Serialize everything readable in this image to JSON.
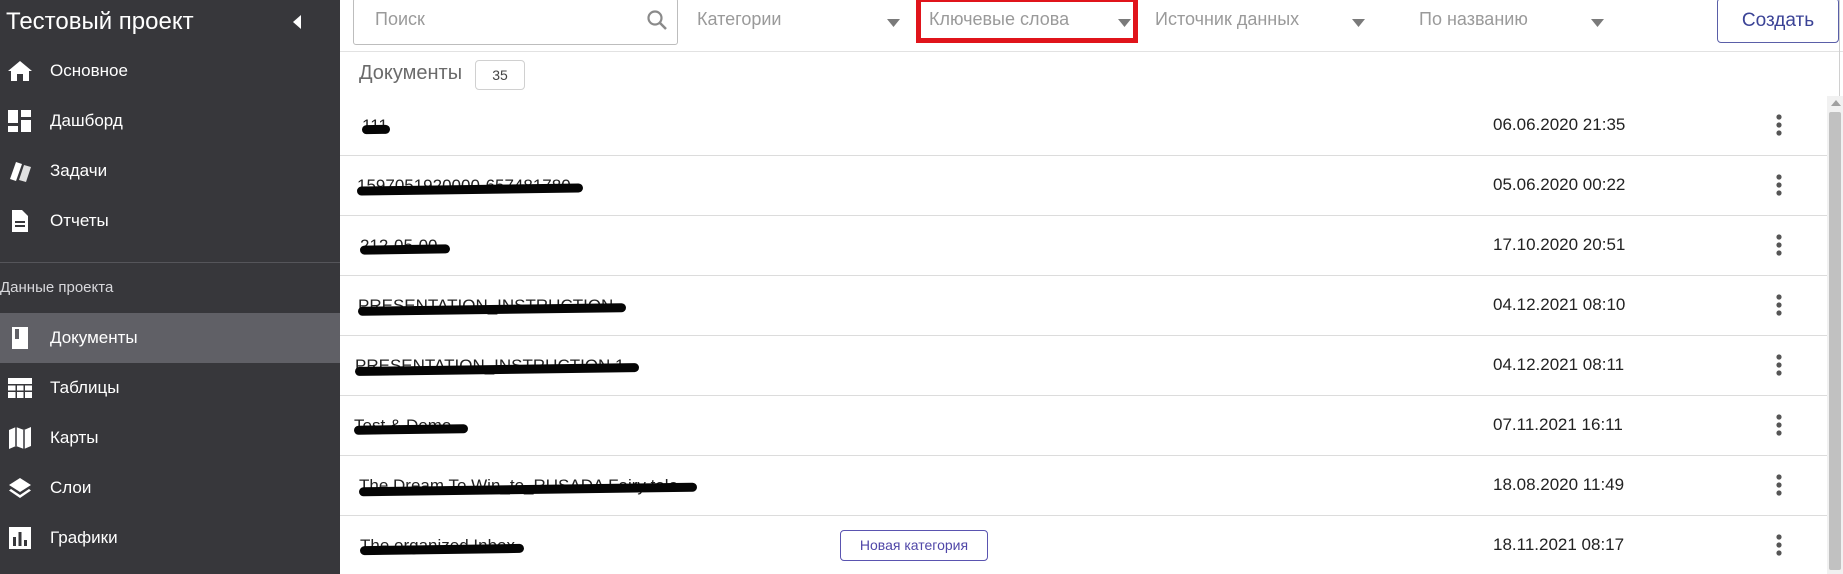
{
  "sidebar": {
    "project_title": "Тестовый проект",
    "nav_items": [
      {
        "label": "Основное",
        "icon": "home-icon"
      },
      {
        "label": "Дашборд",
        "icon": "dashboard-icon"
      },
      {
        "label": "Задачи",
        "icon": "tasks-icon"
      },
      {
        "label": "Отчеты",
        "icon": "document-icon"
      }
    ],
    "section_label": "Данные проекта",
    "data_items": [
      {
        "label": "Документы",
        "icon": "book-icon",
        "active": true
      },
      {
        "label": "Таблицы",
        "icon": "table-icon"
      },
      {
        "label": "Карты",
        "icon": "map-icon"
      },
      {
        "label": "Слои",
        "icon": "layers-icon"
      },
      {
        "label": "Графики",
        "icon": "bar-chart-icon"
      }
    ]
  },
  "toolbar": {
    "search": {
      "placeholder": "Поиск",
      "value": ""
    },
    "filters": {
      "categories": "Категории",
      "keywords": "Ключевые слова",
      "source": "Источник данных",
      "sort": "По названию"
    },
    "create_label": "Создать"
  },
  "content": {
    "title": "Документы",
    "count": "35",
    "documents": [
      {
        "name": "111",
        "date": "06.06.2020 21:35"
      },
      {
        "name": "1597051920000-657481780",
        "date": "05.06.2020 00:22"
      },
      {
        "name": "212-05-00",
        "date": "17.10.2020 20:51"
      },
      {
        "name": "PRESENTATION_INSTRUCTION",
        "date": "04.12.2021 08:10"
      },
      {
        "name": "PRESENTATION_INSTRUCTION 1",
        "date": "04.12.2021 08:11"
      },
      {
        "name": "Test & Demo",
        "date": "07.11.2021 16:11"
      },
      {
        "name": "The Dream To Win_to_RUSADA Fairy tale",
        "date": "18.08.2020 11:49"
      },
      {
        "name": "The organized Inbox",
        "date": "18.11.2021 08:17",
        "category": "Новая категория"
      }
    ]
  },
  "colors": {
    "sidebar_bg": "#37373b",
    "sidebar_active": "#606066",
    "accent": "#3b4396",
    "highlight": "#e0141b"
  }
}
